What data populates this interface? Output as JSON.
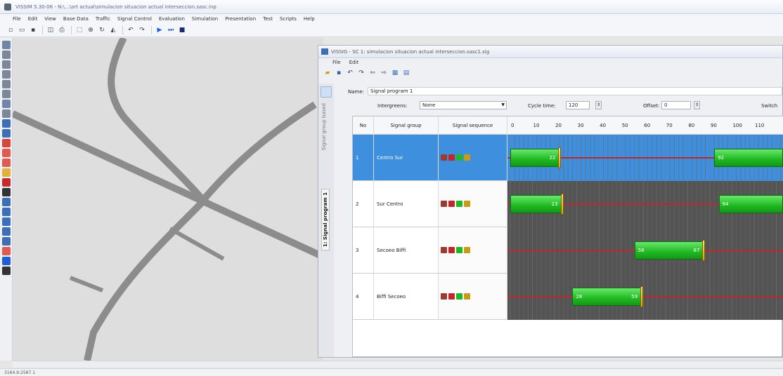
{
  "app": {
    "title": "VISSIM 5.30-06 - N:\\...\\art actual\\simulacion situacion actual interseccion.sasc.inp"
  },
  "menubar": {
    "items": [
      "File",
      "Edit",
      "View",
      "Base Data",
      "Traffic",
      "Signal Control",
      "Evaluation",
      "Simulation",
      "Presentation",
      "Test",
      "Scripts",
      "Help"
    ]
  },
  "toolbar": {
    "icons": [
      "new-icon",
      "open-icon",
      "save-icon",
      "print-preview-icon",
      "print-icon",
      "select-icon",
      "zoom-icon",
      "rotate-icon",
      "3d-icon",
      "undo-icon",
      "redo-icon",
      "play-icon",
      "step-icon",
      "stop-icon"
    ]
  },
  "palette": {
    "icons": [
      {
        "name": "link-tool-icon",
        "color": "#6f86a8"
      },
      {
        "name": "zoom-in-tool-icon",
        "color": "#7a8899"
      },
      {
        "name": "zoom-out-tool-icon",
        "color": "#7a8899"
      },
      {
        "name": "selection-tool-icon",
        "color": "#7a8899"
      },
      {
        "name": "vehicle-input-tool-icon",
        "color": "#7a8899"
      },
      {
        "name": "routing-tool-icon",
        "color": "#7a8899"
      },
      {
        "name": "measure-tool-icon",
        "color": "#6f86a8"
      },
      {
        "name": "parking-tool-icon",
        "color": "#7a8899"
      },
      {
        "name": "transit-tool-icon",
        "color": "#3d6fb8"
      },
      {
        "name": "node-tool-icon",
        "color": "#3d6fb8"
      },
      {
        "name": "conflict-tool-icon",
        "color": "#d6463d"
      },
      {
        "name": "priority-tool-icon",
        "color": "#e05a4f"
      },
      {
        "name": "yield-tool-icon",
        "color": "#e05a4f"
      },
      {
        "name": "reduced-speed-tool-icon",
        "color": "#e0b23a"
      },
      {
        "name": "stop-sign-tool-icon",
        "color": "#c62b2b"
      },
      {
        "name": "signal-head-tool-icon",
        "color": "#333333"
      },
      {
        "name": "detector-tool-icon",
        "color": "#3d6fb8"
      },
      {
        "name": "data-collection-tool-icon",
        "color": "#3d6fb8"
      },
      {
        "name": "travel-time-tool-icon",
        "color": "#3d6fb8"
      },
      {
        "name": "queue-counter-tool-icon",
        "color": "#3d6fb8"
      },
      {
        "name": "delay-tool-icon",
        "color": "#3d6fb8"
      },
      {
        "name": "warning-tool-icon",
        "color": "#e05a4f"
      },
      {
        "name": "pt-stop-tool-icon",
        "color": "#1f5fd6"
      },
      {
        "name": "edit-tool-icon",
        "color": "#333333"
      }
    ]
  },
  "sc_window": {
    "title": "VISSIG - SC 1: simulacion situacion actual interseccion.sasc1.sig",
    "menu": [
      "File",
      "Edit"
    ],
    "toolbar_icons": [
      "new-icon",
      "save-icon",
      "undo-icon",
      "redo-icon",
      "back-icon",
      "forward-icon",
      "view-grid-icon",
      "view-list-icon"
    ],
    "tabs": {
      "signal_group_based": "Signal group based",
      "signal_program": "1: Signal program 1"
    },
    "form": {
      "name_label": "Name:",
      "name_value": "Signal program 1",
      "intergreens_label": "Intergreens:",
      "intergreens_value": "None",
      "cycle_time_label": "Cycle time:",
      "cycle_time_value": "120",
      "offset_label": "Offset:",
      "offset_value": "0",
      "switch_label": "Switch"
    },
    "grid": {
      "headers": {
        "no": "No",
        "signal_group": "Signal group",
        "signal_sequence": "Signal sequence"
      },
      "tick_labels": [
        "0",
        "10",
        "20",
        "30",
        "40",
        "50",
        "60",
        "70",
        "80",
        "90",
        "100",
        "110"
      ],
      "sequence_colors": [
        "#9c3b30",
        "#c0262b",
        "#1fb821",
        "#c79a18"
      ],
      "accent_selected": "#3e8fde"
    }
  },
  "chart_data": {
    "type": "timeline",
    "cycle_time": 120,
    "x_unit": "s",
    "xlim": [
      0,
      123
    ],
    "rows": [
      {
        "no": "1",
        "name": "Centro Sur",
        "selected": true,
        "green": [
          {
            "start": 0,
            "end": 22,
            "start_label": "",
            "end_label": "22"
          },
          {
            "start": 92,
            "end": 123,
            "start_label": "92",
            "end_label": ""
          }
        ]
      },
      {
        "no": "2",
        "name": "Sur Centro",
        "selected": false,
        "green": [
          {
            "start": 0,
            "end": 23,
            "start_label": "",
            "end_label": "23"
          },
          {
            "start": 94,
            "end": 123,
            "start_label": "94",
            "end_label": ""
          }
        ]
      },
      {
        "no": "3",
        "name": "Secoeo Biffi",
        "selected": false,
        "green": [
          {
            "start": 56,
            "end": 87,
            "start_label": "56",
            "end_label": "87"
          }
        ]
      },
      {
        "no": "4",
        "name": "Biffi Secoeo",
        "selected": false,
        "green": [
          {
            "start": 28,
            "end": 59,
            "start_label": "28",
            "end_label": "59"
          }
        ]
      }
    ]
  },
  "statusbar": {
    "coords": "3164.9:2587.1"
  }
}
